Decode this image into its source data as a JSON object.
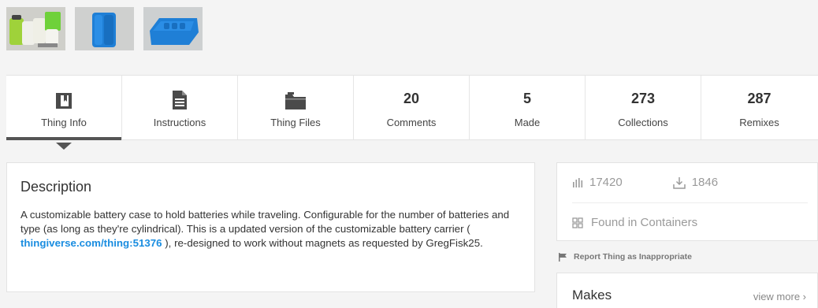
{
  "thumbnails": [
    {
      "name": "battery-case-photo"
    },
    {
      "name": "battery-case-blue-render"
    },
    {
      "name": "battery-case-open-render"
    }
  ],
  "tabs": [
    {
      "label": "Thing Info",
      "icon": "book-icon",
      "active": true
    },
    {
      "label": "Instructions",
      "icon": "document-icon"
    },
    {
      "label": "Thing Files",
      "icon": "folder-icon"
    },
    {
      "count": "20",
      "label": "Comments"
    },
    {
      "count": "5",
      "label": "Made"
    },
    {
      "count": "273",
      "label": "Collections"
    },
    {
      "count": "287",
      "label": "Remixes"
    }
  ],
  "description": {
    "title": "Description",
    "text_before": "A customizable battery case to hold batteries while traveling. Configurable for the number of batteries and type (as long as they're cylindrical). This is a updated version of the customizable battery carrier ( ",
    "link": "thingiverse.com/thing:51376",
    "text_after": " ), re-designed to work without magnets as requested by GregFisk25."
  },
  "stats": {
    "views": "17420",
    "downloads": "1846",
    "found_in": "Found in Containers"
  },
  "report": "Report Thing as Inappropriate",
  "makes": {
    "title": "Makes",
    "view_more": "view more ›"
  },
  "colors": {
    "link": "#1a8de0",
    "active_tab": "#555555",
    "part_blue": "#1f7fd6"
  }
}
